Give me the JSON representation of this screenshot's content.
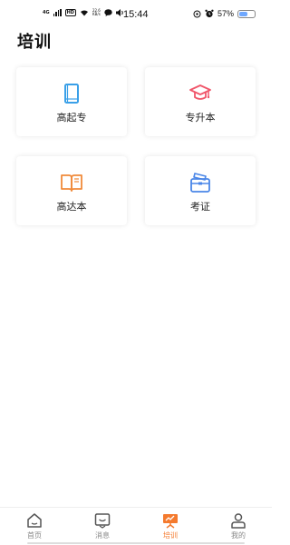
{
  "status_bar": {
    "network": "4G",
    "hd": "HD",
    "speed_value": "22.6",
    "speed_unit": "KB/s",
    "time": "15:44",
    "battery": "57%",
    "battery_level": 0.57
  },
  "page": {
    "title": "培训"
  },
  "cards": [
    {
      "label": "高起专",
      "icon": "book-icon",
      "color": "#3aa0e8"
    },
    {
      "label": "专升本",
      "icon": "graduation-cap-icon",
      "color": "#f0566a"
    },
    {
      "label": "高达本",
      "icon": "open-book-icon",
      "color": "#f08a3a"
    },
    {
      "label": "考证",
      "icon": "certificate-folder-icon",
      "color": "#4a86e8"
    }
  ],
  "nav": {
    "items": [
      {
        "label": "首页",
        "icon": "home-icon"
      },
      {
        "label": "消息",
        "icon": "message-icon"
      },
      {
        "label": "培训",
        "icon": "training-board-icon",
        "active": true
      },
      {
        "label": "我的",
        "icon": "user-icon"
      }
    ],
    "active_color": "#f47a2e"
  }
}
